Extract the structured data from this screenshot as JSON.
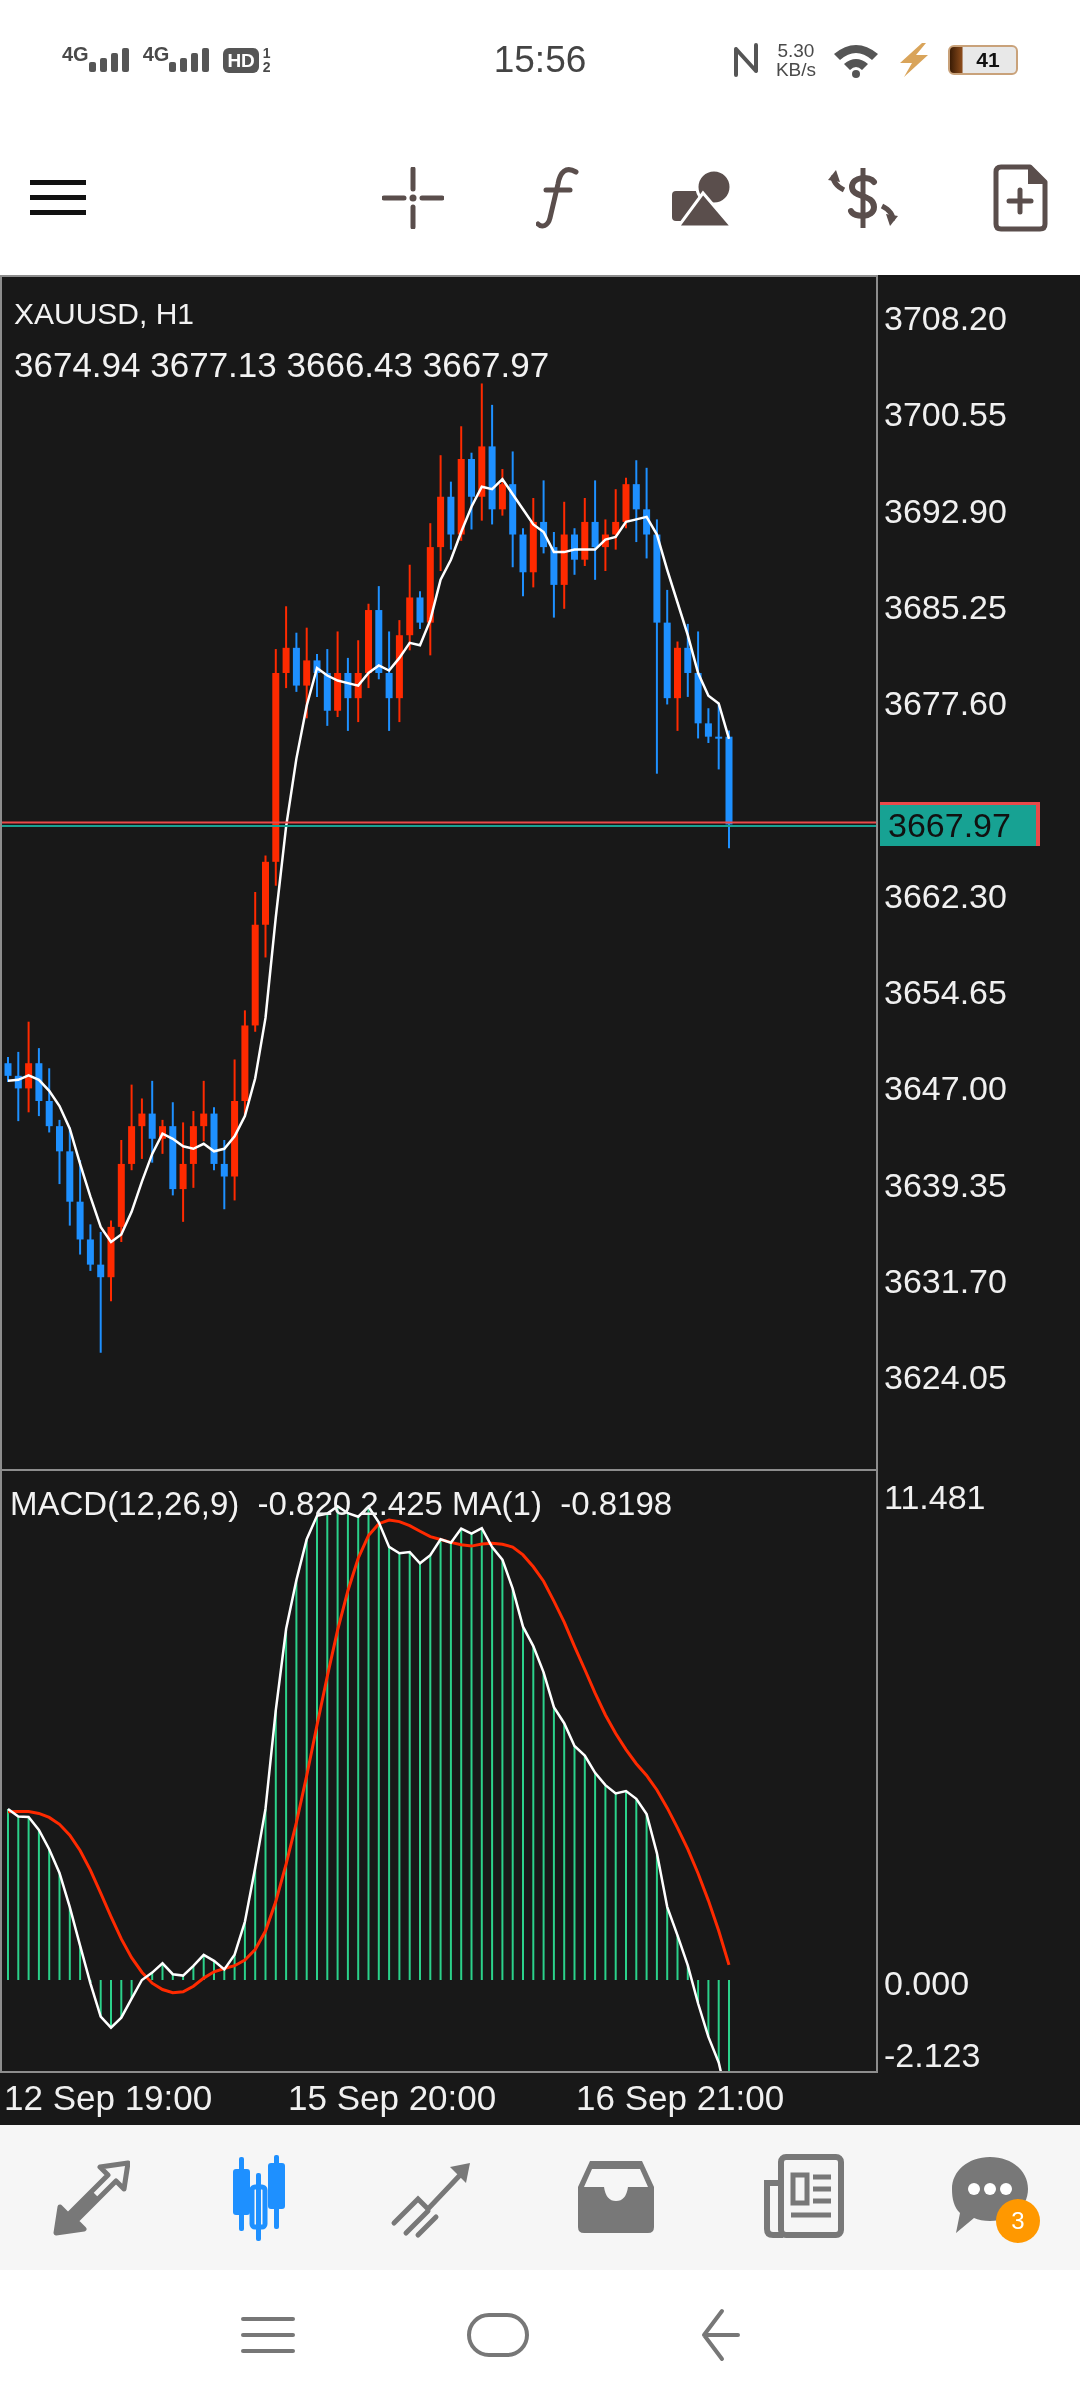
{
  "status_bar": {
    "sims": [
      "4G",
      "4G"
    ],
    "hd": "HD",
    "hd_slots": [
      "1",
      "2"
    ],
    "time": "15:56",
    "speed": "5.30",
    "speed_unit": "KB/s",
    "battery": "41"
  },
  "chart": {
    "symbol": "XAUUSD, H1",
    "ohlc": "3674.94 3677.13 3666.43 3667.97",
    "price_ticks": [
      "3708.20",
      "3700.55",
      "3692.90",
      "3685.25",
      "3677.60",
      "3662.30",
      "3654.65",
      "3647.00",
      "3639.35",
      "3631.70",
      "3624.05"
    ],
    "current_price": "3667.97"
  },
  "macd": {
    "label": "MACD(12,26,9)  -0.820 2.425 MA(1)  -0.8198",
    "ticks": [
      "11.481",
      "0.000",
      "-2.123"
    ]
  },
  "time_labels": [
    "12 Sep 19:00",
    "15 Sep 20:00",
    "16 Sep 21:00"
  ],
  "tabs": [
    {
      "selected": false
    },
    {
      "selected": true
    },
    {
      "selected": false
    },
    {
      "selected": false
    },
    {
      "selected": false
    },
    {
      "selected": false,
      "badge": "3"
    }
  ]
}
